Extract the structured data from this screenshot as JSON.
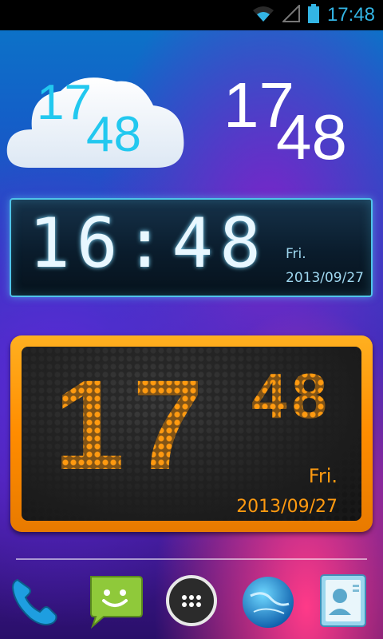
{
  "status_bar": {
    "time": "17:48",
    "icons": [
      "wifi-icon",
      "signal-icon",
      "battery-icon"
    ]
  },
  "cloud_clock": {
    "hours": "17",
    "minutes": "48"
  },
  "white_clock": {
    "hours": "17",
    "minutes": "48"
  },
  "lcd_clock": {
    "time": "16:48",
    "day": "Fri.",
    "date": "2013/09/27"
  },
  "orange_clock": {
    "hours": "17",
    "minutes": "48",
    "day": "Fri.",
    "date": "2013/09/27"
  },
  "dock": {
    "items": [
      "phone-icon",
      "messaging-icon",
      "app-drawer-icon",
      "browser-icon",
      "contacts-icon"
    ]
  },
  "colors": {
    "status_accent": "#33b5e5",
    "cloud_digits": "#22c8ef",
    "orange": "#ff9a10",
    "lcd_border": "#4fc3ea"
  }
}
